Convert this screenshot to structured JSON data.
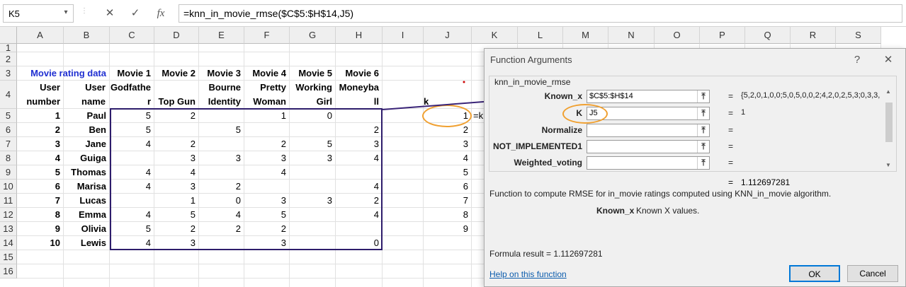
{
  "formula_bar": {
    "name_box": "K5",
    "cancel_icon": "close-icon",
    "enter_icon": "check-icon",
    "fx_label": "fx",
    "formula": "=knn_in_movie_rmse($C$5:$H$14,J5)"
  },
  "columns": [
    "A",
    "B",
    "C",
    "D",
    "E",
    "F",
    "G",
    "H",
    "I",
    "J",
    "K",
    "L",
    "M",
    "N",
    "O",
    "P",
    "Q",
    "R",
    "S"
  ],
  "rows": [
    "1",
    "2",
    "3",
    "4",
    "5",
    "6",
    "7",
    "8",
    "9",
    "10",
    "11",
    "12",
    "13",
    "14",
    "15",
    "16"
  ],
  "sheet": {
    "title": "Movie rating data",
    "user_header": [
      "User",
      "number"
    ],
    "name_header": [
      "User",
      "name"
    ],
    "movie_numbers": [
      "Movie 1",
      "Movie 2",
      "Movie 3",
      "Movie 4",
      "Movie 5",
      "Movie 6"
    ],
    "movie_row4": [
      "Godfathe",
      "Top Gun",
      "Identity",
      "Woman",
      "Girl",
      "ll"
    ],
    "movie_row3b": [
      "",
      "",
      "Bourne",
      "Pretty",
      "Working",
      "Moneyba"
    ],
    "movie_r": "r",
    "k_label": "k",
    "k_values": [
      "1",
      "2",
      "3",
      "4",
      "5",
      "6",
      "7",
      "8",
      "9"
    ],
    "k5_overflow": "=k",
    "users": [
      {
        "n": "1",
        "name": "Paul",
        "r": [
          "5",
          "2",
          "",
          "1",
          "0",
          ""
        ]
      },
      {
        "n": "2",
        "name": "Ben",
        "r": [
          "5",
          "",
          "5",
          "",
          "",
          "2"
        ]
      },
      {
        "n": "3",
        "name": "Jane",
        "r": [
          "4",
          "2",
          "",
          "2",
          "5",
          "3"
        ]
      },
      {
        "n": "4",
        "name": "Guiga",
        "r": [
          "",
          "3",
          "3",
          "3",
          "3",
          "4"
        ]
      },
      {
        "n": "5",
        "name": "Thomas",
        "r": [
          "4",
          "4",
          "",
          "4",
          "",
          ""
        ]
      },
      {
        "n": "6",
        "name": "Marisa",
        "r": [
          "4",
          "3",
          "2",
          "",
          "",
          "4"
        ]
      },
      {
        "n": "7",
        "name": "Lucas",
        "r": [
          "",
          "1",
          "0",
          "3",
          "3",
          "2"
        ]
      },
      {
        "n": "8",
        "name": "Emma",
        "r": [
          "4",
          "5",
          "4",
          "5",
          "",
          "4"
        ]
      },
      {
        "n": "9",
        "name": "Olivia",
        "r": [
          "5",
          "2",
          "2",
          "2",
          "",
          ""
        ]
      },
      {
        "n": "10",
        "name": "Lewis",
        "r": [
          "4",
          "3",
          "",
          "3",
          "",
          "0"
        ]
      }
    ]
  },
  "dialog": {
    "title": "Function Arguments",
    "help_icon": "?",
    "close_icon": "close-icon",
    "function_name": "knn_in_movie_rmse",
    "args": [
      {
        "label": "Known_x",
        "value": "$C$5:$H$14",
        "result": "{5,2,0,1,0,0;5,0,5,0,0,2;4,2,0,2,5,3;0,3,3,"
      },
      {
        "label": "K",
        "value": "J5",
        "result": "1"
      },
      {
        "label": "Normalize",
        "value": "",
        "result": ""
      },
      {
        "label": "NOT_IMPLEMENTED1",
        "value": "",
        "result": ""
      },
      {
        "label": "Weighted_voting",
        "value": "",
        "result": ""
      }
    ],
    "eq": "=",
    "function_result": "1.112697281",
    "description": "Function to compute RMSE for in_movie ratings computed using KNN_in_movie algorithm.",
    "arg_desc_name": "Known_x",
    "arg_desc_text": "Known X values.",
    "formula_result": "Formula result =   1.112697281",
    "help_link": "Help on this function",
    "ok": "OK",
    "cancel": "Cancel"
  },
  "colors": {
    "title_blue": "#1f2fd1",
    "box_border": "#2e1d6b",
    "arrow": "#3a2478",
    "highlight_ring": "#f0a030"
  }
}
